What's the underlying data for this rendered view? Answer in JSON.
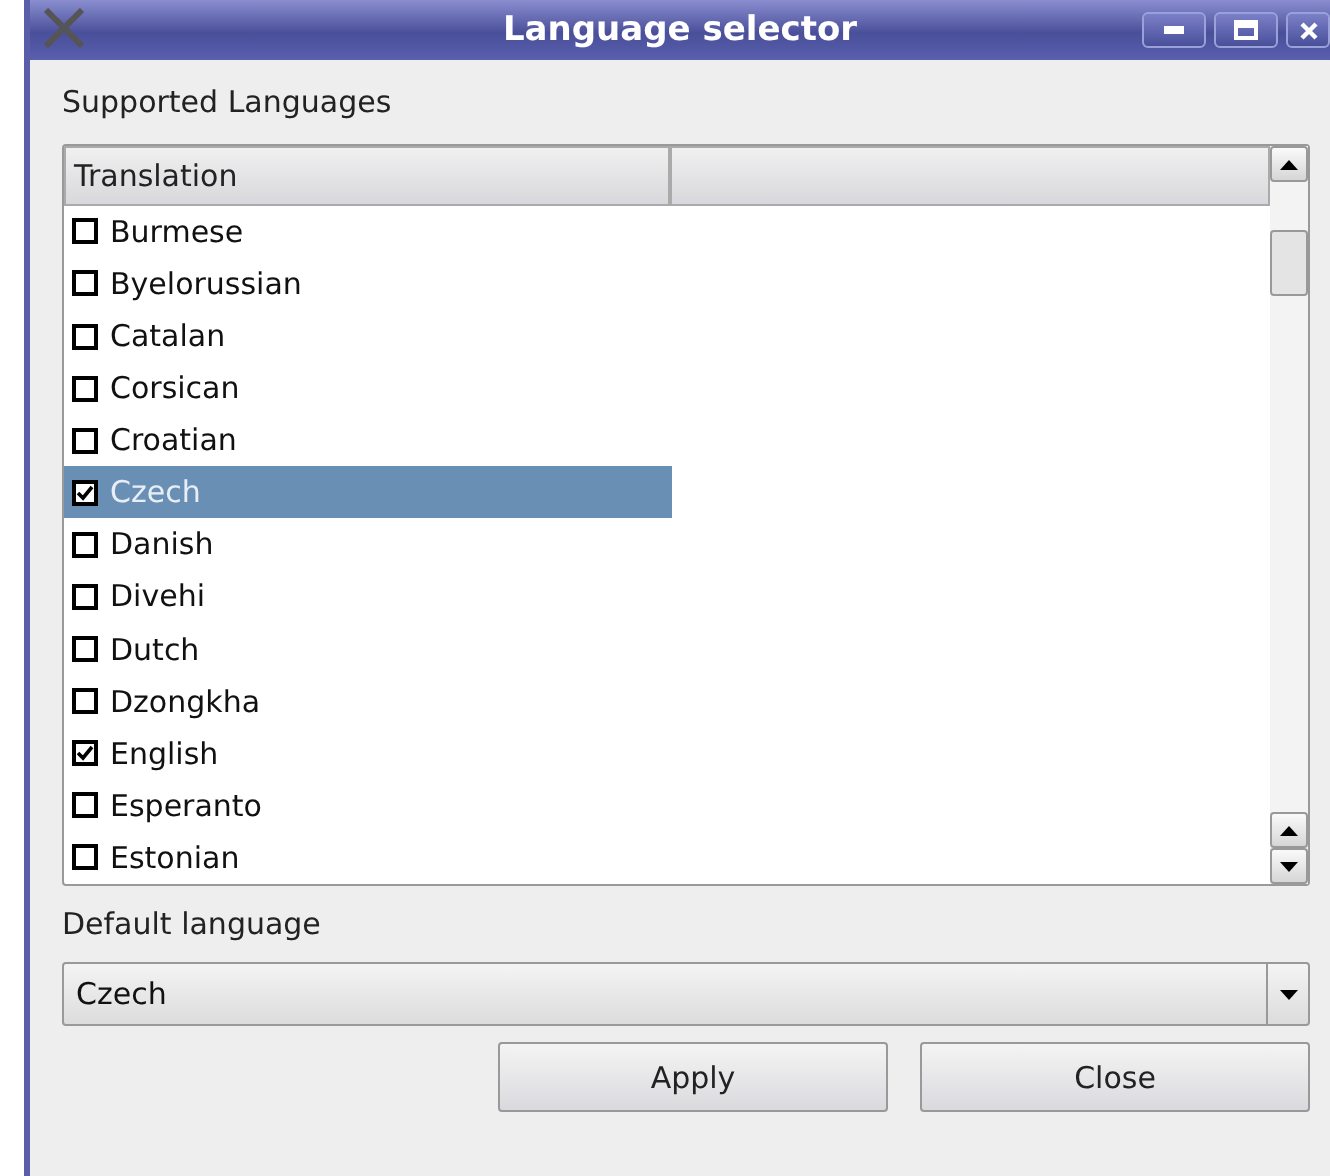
{
  "window": {
    "title": "Language selector"
  },
  "supported_label": "Supported Languages",
  "table": {
    "columns": [
      "Translation"
    ],
    "rows": [
      {
        "label": "Burmese",
        "checked": false,
        "selected": false
      },
      {
        "label": "Byelorussian",
        "checked": false,
        "selected": false
      },
      {
        "label": "Catalan",
        "checked": false,
        "selected": false
      },
      {
        "label": "Corsican",
        "checked": false,
        "selected": false
      },
      {
        "label": "Croatian",
        "checked": false,
        "selected": false
      },
      {
        "label": "Czech",
        "checked": true,
        "selected": true
      },
      {
        "label": "Danish",
        "checked": false,
        "selected": false
      },
      {
        "label": "Divehi",
        "checked": false,
        "selected": false
      },
      {
        "label": "Dutch",
        "checked": false,
        "selected": false
      },
      {
        "label": "Dzongkha",
        "checked": false,
        "selected": false
      },
      {
        "label": "English",
        "checked": true,
        "selected": false
      },
      {
        "label": "Esperanto",
        "checked": false,
        "selected": false
      },
      {
        "label": "Estonian",
        "checked": false,
        "selected": false
      }
    ]
  },
  "default_label": "Default language",
  "default_select": {
    "value": "Czech"
  },
  "buttons": [
    "Apply",
    "Close"
  ]
}
